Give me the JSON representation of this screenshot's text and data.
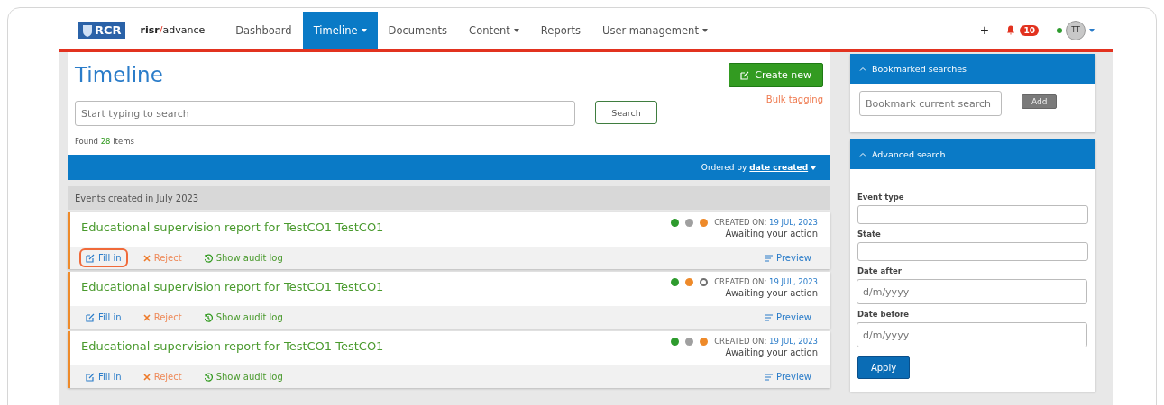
{
  "nav": {
    "logo_text": "RCR",
    "brand_prefix": "risr",
    "brand_slash": "/",
    "brand_suffix": "advance",
    "items": [
      {
        "label": "Dashboard",
        "selected": false,
        "dropdown": false
      },
      {
        "label": "Timeline",
        "selected": true,
        "dropdown": true
      },
      {
        "label": "Documents",
        "selected": false,
        "dropdown": false
      },
      {
        "label": "Content",
        "selected": false,
        "dropdown": true
      },
      {
        "label": "Reports",
        "selected": false,
        "dropdown": false
      },
      {
        "label": "User management",
        "selected": false,
        "dropdown": true
      }
    ],
    "plus": "+",
    "notifications": "10",
    "avatar": "TT",
    "online": true
  },
  "page": {
    "title": "Timeline",
    "create_button": "Create new",
    "bulk_link": "Bulk tagging",
    "search": {
      "placeholder": "Start typing to search"
    },
    "search_button": "Search",
    "found_prefix": "Found",
    "found_count": "28",
    "found_suffix": "items",
    "order_prefix": "Ordered by",
    "order_value": "date created"
  },
  "group": "Events created in July 2023",
  "events": [
    {
      "title": "Educational supervision report for TestCO1 TestCO1",
      "dots": [
        {
          "color": "#2e9b2e",
          "filled": true
        },
        {
          "color": "#a0a0a0",
          "filled": true
        },
        {
          "color": "#ee8a2a",
          "filled": true
        }
      ],
      "created_label": "CREATED ON:",
      "created_date": "19 JUL, 2023",
      "status": "Awaiting your action",
      "highlighted": true,
      "actions": {
        "fill": "Fill in",
        "reject": "Reject",
        "audit": "Show audit log",
        "preview": "Preview"
      }
    },
    {
      "title": "Educational supervision report for TestCO1 TestCO1",
      "dots": [
        {
          "color": "#2e9b2e",
          "filled": true
        },
        {
          "color": "#ee8a2a",
          "filled": true
        },
        {
          "color": "#707070",
          "filled": false
        }
      ],
      "created_label": "CREATED ON:",
      "created_date": "19 JUL, 2023",
      "status": "Awaiting your action",
      "highlighted": false,
      "actions": {
        "fill": "Fill in",
        "reject": "Reject",
        "audit": "Show audit log",
        "preview": "Preview"
      }
    },
    {
      "title": "Educational supervision report for TestCO1 TestCO1",
      "dots": [
        {
          "color": "#2e9b2e",
          "filled": true
        },
        {
          "color": "#a0a0a0",
          "filled": true
        },
        {
          "color": "#ee8a2a",
          "filled": true
        }
      ],
      "created_label": "CREATED ON:",
      "created_date": "19 JUL, 2023",
      "status": "Awaiting your action",
      "highlighted": false,
      "actions": {
        "fill": "Fill in",
        "reject": "Reject",
        "audit": "Show audit log",
        "preview": "Preview"
      }
    }
  ],
  "bookmarks": {
    "title": "Bookmarked searches",
    "field": {
      "placeholder": "Bookmark current search"
    },
    "button": "Add"
  },
  "advanced": {
    "title": "Advanced search",
    "fields": [
      {
        "label": "Event type"
      },
      {
        "label": "State"
      },
      {
        "label": "Date after",
        "placeholder": "d/m/yyyy"
      },
      {
        "label": "Date before",
        "placeholder": "d/m/yyyy"
      }
    ],
    "button": "Apply"
  }
}
